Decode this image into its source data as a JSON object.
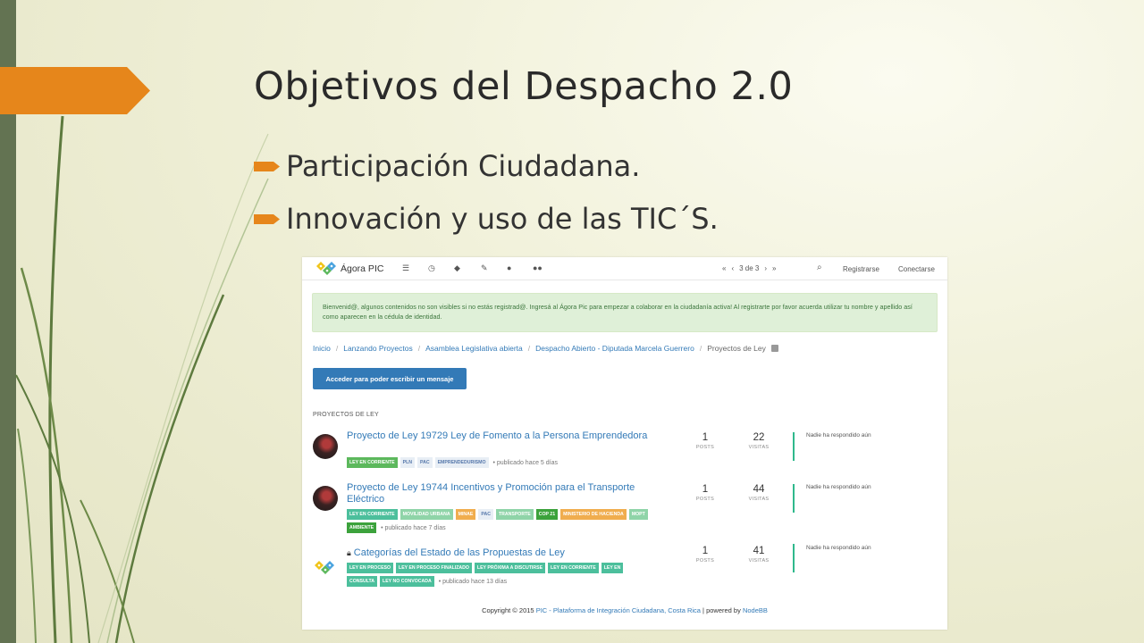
{
  "slide": {
    "title": "Objetivos del Despacho 2.0",
    "bullets": [
      "Participación Ciudadana.",
      "Innovación y uso de las TIC´S."
    ],
    "accent_color": "#e6861b",
    "sidebar_color": "#637352"
  },
  "forum": {
    "nav": {
      "brand": "Ágora PIC",
      "icons": [
        "list-icon",
        "clock-icon",
        "tags-icon",
        "pencil-icon",
        "user-icon",
        "group-icon"
      ],
      "pager": "3 de 3",
      "register_label": "Registrarse",
      "login_label": "Conectarse"
    },
    "alert": "Bienvenid@, algunos contenidos no son visibles si no estás registrad@. Ingresá al Ágora Pic para empezar a colaborar en la ciudadanía activa! Al registrarte por favor acuerda utilizar tu nombre y apellido así como aparecen en la cédula de identidad.",
    "breadcrumbs": [
      "Inicio",
      "Lanzando Proyectos",
      "Asamblea Legislativa abierta",
      "Despacho Abierto - Diputada Marcela Guerrero"
    ],
    "current_page": "Proyectos de Ley",
    "post_button": "Acceder para poder escribir un mensaje",
    "category_heading": "PROYECTOS DE LEY",
    "posts_label": "POSTS",
    "views_label": "VISITAS",
    "topics": [
      {
        "title": "Proyecto de Ley 19729 Ley de Fomento a la Persona Emprendedora",
        "tags": [
          "LEY EN CORRIENTE",
          "PLN",
          "PAC",
          "EMPRENDEDURISMO"
        ],
        "meta": "• publicado hace 5 días",
        "posts": "1",
        "views": "22",
        "reply": "Nadie ha respondido aún"
      },
      {
        "title": "Proyecto de Ley 19744 Incentivos y Promoción para el Transporte Eléctrico",
        "tags": [
          "LEY EN CORRIENTE",
          "MOVILIDAD URBANA",
          "MINAE",
          "PAC",
          "TRANSPORTE",
          "COP 21",
          "MINISTERIO DE HACIENDA",
          "MOPT",
          "AMBIENTE"
        ],
        "meta": "• publicado hace 7 días",
        "posts": "1",
        "views": "44",
        "reply": "Nadie ha respondido aún"
      },
      {
        "title": "Categorías del Estado de las Propuestas de Ley",
        "tags": [
          "LEY EN PROCESO",
          "LEY EN PROCESO FINALIZADO",
          "LEY PRÓXIMA A DISCUTIRSE",
          "LEY EN CORRIENTE",
          "LEY EN",
          "CONSULTA",
          "LEY NO CONVOCADA"
        ],
        "meta": "• publicado hace 13 días",
        "posts": "1",
        "views": "41",
        "reply": "Nadie ha respondido aún"
      }
    ],
    "footer": {
      "prefix": "Copyright © 2015",
      "link1": "PIC - Plataforma de Integración Ciudadana, Costa Rica",
      "middle": "| powered by",
      "link2": "NodeBB"
    }
  }
}
